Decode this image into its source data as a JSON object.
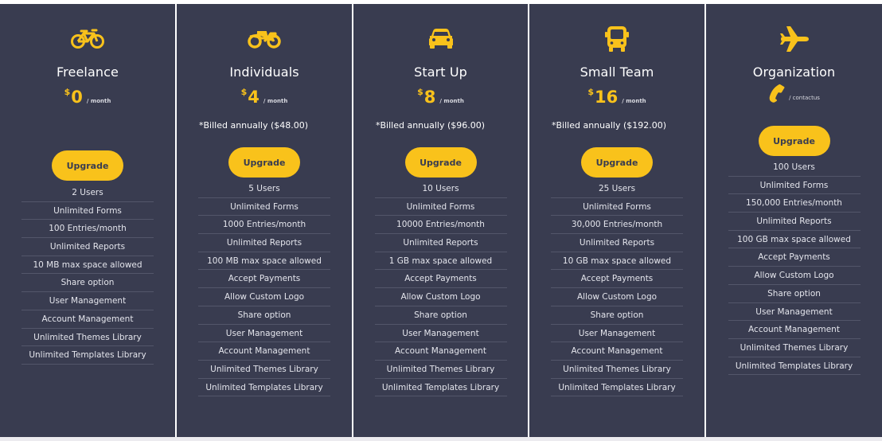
{
  "colors": {
    "card_background": "#393c50",
    "accent": "#f9c21b",
    "text": "#ffffff",
    "divider": "#53566a"
  },
  "plans": [
    {
      "icon": "bicycle-icon",
      "name": "Freelance",
      "currency": "$",
      "price": "0",
      "period": "/ month",
      "billed": "",
      "button": "Upgrade",
      "features": [
        "2 Users",
        "Unlimited Forms",
        "100 Entries/month",
        "Unlimited Reports",
        "10 MB max space allowed",
        "Share option",
        "User Management",
        "Account Management",
        "Unlimited Themes Library",
        "Unlimited Templates Library"
      ]
    },
    {
      "icon": "motorcycle-icon",
      "name": "Individuals",
      "currency": "$",
      "price": "4",
      "period": "/ month",
      "billed": "*Billed annually ($48.00)",
      "button": "Upgrade",
      "features": [
        "5 Users",
        "Unlimited Forms",
        "1000 Entries/month",
        "Unlimited Reports",
        "100 MB max space allowed",
        "Accept Payments",
        "Allow Custom Logo",
        "Share option",
        "User Management",
        "Account Management",
        "Unlimited Themes Library",
        "Unlimited Templates Library"
      ]
    },
    {
      "icon": "car-icon",
      "name": "Start Up",
      "currency": "$",
      "price": "8",
      "period": "/ month",
      "billed": "*Billed annually ($96.00)",
      "button": "Upgrade",
      "features": [
        "10 Users",
        "Unlimited Forms",
        "10000 Entries/month",
        "Unlimited Reports",
        "1 GB max space allowed",
        "Accept Payments",
        "Allow Custom Logo",
        "Share option",
        "User Management",
        "Account Management",
        "Unlimited Themes Library",
        "Unlimited Templates Library"
      ]
    },
    {
      "icon": "bus-icon",
      "name": "Small Team",
      "currency": "$",
      "price": "16",
      "period": "/ month",
      "billed": "*Billed annually ($192.00)",
      "button": "Upgrade",
      "features": [
        "25 Users",
        "Unlimited Forms",
        "30,000 Entries/month",
        "Unlimited Reports",
        "10 GB max space allowed",
        "Accept Payments",
        "Allow Custom Logo",
        "Share option",
        "User Management",
        "Account Management",
        "Unlimited Themes Library",
        "Unlimited Templates Library"
      ]
    },
    {
      "icon": "airplane-icon",
      "name": "Organization",
      "contact_icon": "phone-icon",
      "period": "/ contactus",
      "button": "Upgrade",
      "features": [
        "100 Users",
        "Unlimited Forms",
        "150,000 Entries/month",
        "Unlimited Reports",
        "100 GB max space allowed",
        "Accept Payments",
        "Allow Custom Logo",
        "Share option",
        "User Management",
        "Account Management",
        "Unlimited Themes Library",
        "Unlimited Templates Library"
      ]
    }
  ]
}
